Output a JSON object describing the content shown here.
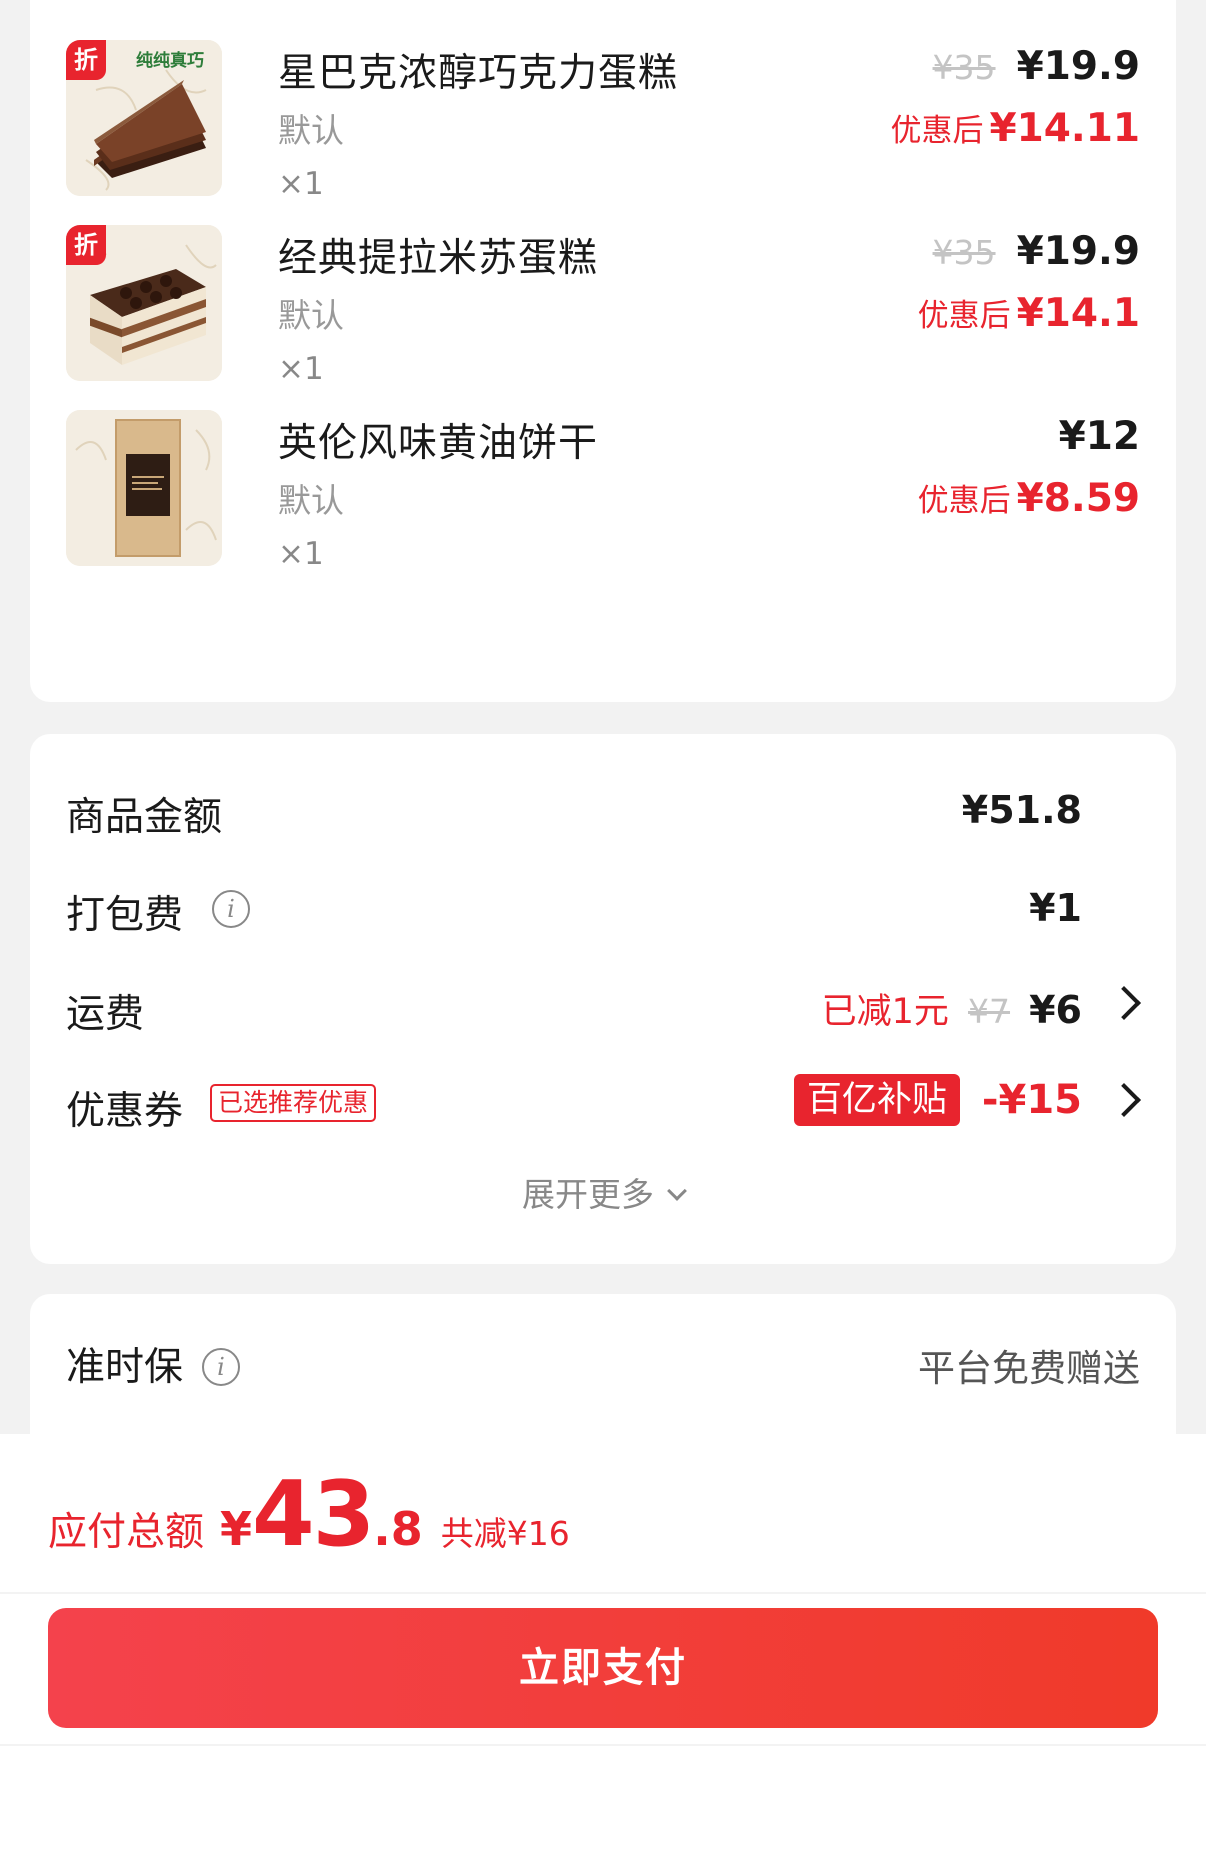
{
  "items": [
    {
      "name": "星巴克浓醇巧克力蛋糕",
      "spec": "默认",
      "qty": "×1",
      "badge": "折",
      "brand_tag": "纯纯真巧",
      "orig_price": "¥35",
      "price": "¥19.9",
      "after_label": "优惠后",
      "after_price": "¥14.11",
      "image": "chocolate-cake"
    },
    {
      "name": "经典提拉米苏蛋糕",
      "spec": "默认",
      "qty": "×1",
      "badge": "折",
      "orig_price": "¥35",
      "price": "¥19.9",
      "after_label": "优惠后",
      "after_price": "¥14.1",
      "image": "tiramisu"
    },
    {
      "name": "英伦风味黄油饼干",
      "spec": "默认",
      "qty": "×1",
      "price": "¥12",
      "after_label": "优惠后",
      "after_price": "¥8.59",
      "image": "cookie-bag"
    }
  ],
  "summary": {
    "goods_label": "商品金额",
    "goods_value": "¥51.8",
    "packing_label": "打包费",
    "packing_value": "¥1",
    "shipping_label": "运费",
    "shipping_reduced": "已减1元",
    "shipping_orig": "¥7",
    "shipping_value": "¥6",
    "coupon_label": "优惠券",
    "coupon_tag": "已选推荐优惠",
    "coupon_badge": "百亿补贴",
    "coupon_value": "-¥15",
    "expand_label": "展开更多"
  },
  "ontime": {
    "label": "准时保",
    "value": "平台免费赠送"
  },
  "footer": {
    "total_label": "应付总额",
    "currency": "¥",
    "total_int": "43",
    "total_dec": ".8",
    "saved": "共减¥16",
    "pay_button": "立即支付"
  },
  "colors": {
    "accent": "#e8242e",
    "background": "#f2f2f2"
  }
}
